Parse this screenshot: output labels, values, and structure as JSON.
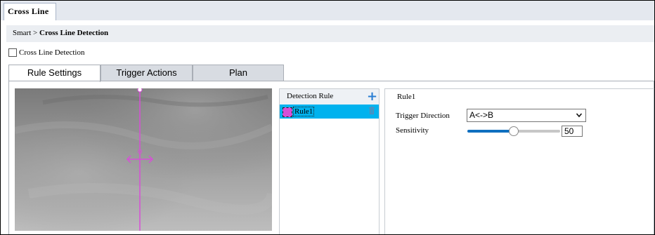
{
  "top_tab": {
    "label": "Cross Line"
  },
  "breadcrumb": {
    "parent": "Smart",
    "separator": ">",
    "current": "Cross Line Detection"
  },
  "enable": {
    "label": "Cross Line Detection",
    "checked": false
  },
  "tabs": [
    {
      "label": "Rule Settings",
      "active": true
    },
    {
      "label": "Trigger Actions",
      "active": false
    },
    {
      "label": "Plan",
      "active": false
    }
  ],
  "rule_panel": {
    "title": "Detection Rule",
    "rules": [
      {
        "label": "Rule1",
        "color": "#d74fd7",
        "selected": true
      }
    ]
  },
  "settings": {
    "rule_name": "Rule1",
    "direction_label": "Trigger Direction",
    "direction_value": "A<->B",
    "sensitivity_label": "Sensitivity",
    "sensitivity_value": "50"
  },
  "colors": {
    "accent": "#00b2ee",
    "slider": "#0f6fbf",
    "line": "#d74fd7",
    "add": "#2a7ed3"
  },
  "icons": {
    "add": "plus-icon",
    "delete": "trash-icon",
    "dropdown": "chevron-down-icon"
  }
}
